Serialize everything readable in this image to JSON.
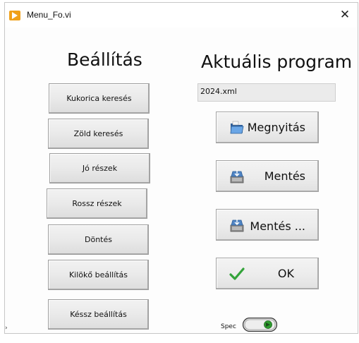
{
  "window": {
    "title": "Menu_Fo.vi",
    "close_glyph": "✕"
  },
  "left_panel": {
    "heading": "Beállítás",
    "buttons": [
      {
        "label": "Kukorica keresés"
      },
      {
        "label": "Zöld keresés"
      },
      {
        "label": "Jó részek"
      },
      {
        "label": "Rossz részek"
      },
      {
        "label": "Döntés"
      },
      {
        "label": "Kilökő beállítás"
      },
      {
        "label": "Késsz beállítás"
      }
    ]
  },
  "right_panel": {
    "heading": "Aktuális program",
    "program_value": "2024.xml",
    "buttons": [
      {
        "label": "Megnyitás",
        "icon": "folder-open-icon"
      },
      {
        "label": "Mentés",
        "icon": "save-icon"
      },
      {
        "label": "Mentés ...",
        "icon": "save-as-icon"
      },
      {
        "label": "OK",
        "icon": "checkmark-icon"
      }
    ]
  },
  "spec": {
    "label": "Spec",
    "state": "on",
    "indicator_color": "#2f9d2f"
  },
  "edge_mark": "›"
}
